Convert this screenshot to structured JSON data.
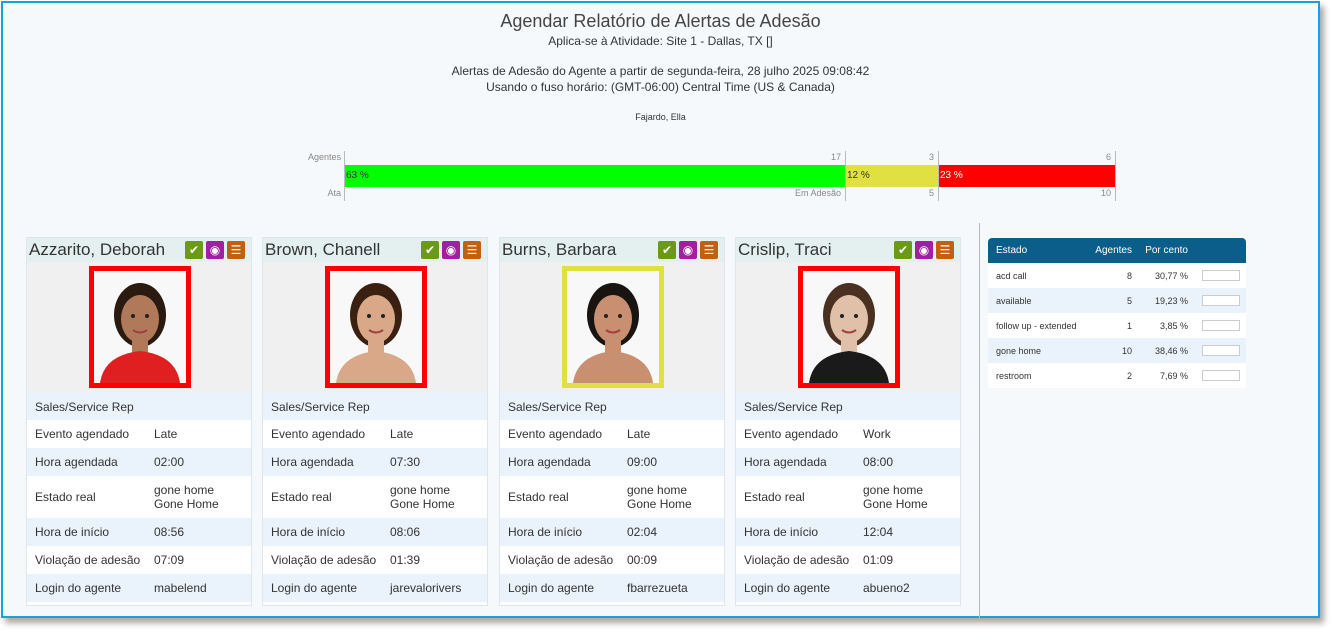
{
  "header": {
    "title": "Agendar Relatório de Alertas de Adesão",
    "subtitle": "Aplica-se à Atividade: Site 1 - Dallas, TX []",
    "alert_line1": "Alertas de Adesão do Agente a partir de segunda-feira, 28 julho 2025 09:08:42",
    "alert_line2": "Usando o fuso horário: (GMT-06:00) Central Time (US & Canada)",
    "agent_name": "Fajardo, Ella"
  },
  "bar": {
    "label_top": "Agentes",
    "label_bottom": "Ata",
    "segments": [
      {
        "label": "63 %",
        "fraction": 0.65,
        "color": "#00ff00",
        "count": "17",
        "bottom": "Em Adesão"
      },
      {
        "label": "12 %",
        "fraction": 0.12,
        "color": "#e0e040",
        "count": "3",
        "bottom": "5"
      },
      {
        "label": "23 %",
        "fraction": 0.23,
        "color": "#ff0000",
        "count": "6",
        "bottom": "10"
      }
    ]
  },
  "cards": [
    {
      "name": "Azzarito, Deborah",
      "border_color": "#ff0000",
      "role": "Sales/Service Rep",
      "rows": [
        {
          "key": "Evento agendado",
          "value": "Late"
        },
        {
          "key": "Hora agendada",
          "value": "02:00"
        },
        {
          "key": "Estado real",
          "value": "gone home",
          "value2": "Gone Home"
        },
        {
          "key": "Hora de início",
          "value": "08:56"
        },
        {
          "key": "Violação de adesão",
          "value": "07:09"
        },
        {
          "key": "Login do agente",
          "value": "mabelend"
        }
      ]
    },
    {
      "name": "Brown, Chanell",
      "border_color": "#ff0000",
      "role": "Sales/Service Rep",
      "rows": [
        {
          "key": "Evento agendado",
          "value": "Late"
        },
        {
          "key": "Hora agendada",
          "value": "07:30"
        },
        {
          "key": "Estado real",
          "value": "gone home",
          "value2": "Gone Home"
        },
        {
          "key": "Hora de início",
          "value": "08:06"
        },
        {
          "key": "Violação de adesão",
          "value": "01:39"
        },
        {
          "key": "Login do agente",
          "value": "jarevalorivers"
        }
      ]
    },
    {
      "name": "Burns, Barbara",
      "border_color": "#e0e040",
      "role": "Sales/Service Rep",
      "rows": [
        {
          "key": "Evento agendado",
          "value": "Late"
        },
        {
          "key": "Hora agendada",
          "value": "09:00"
        },
        {
          "key": "Estado real",
          "value": "gone home",
          "value2": "Gone Home"
        },
        {
          "key": "Hora de início",
          "value": "02:04"
        },
        {
          "key": "Violação de adesão",
          "value": "00:09"
        },
        {
          "key": "Login do agente",
          "value": "fbarrezueta"
        }
      ]
    },
    {
      "name": "Crislip, Traci",
      "border_color": "#ff0000",
      "role": "Sales/Service Rep",
      "rows": [
        {
          "key": "Evento agendado",
          "value": "Work"
        },
        {
          "key": "Hora agendada",
          "value": "08:00"
        },
        {
          "key": "Estado real",
          "value": "gone home",
          "value2": "Gone Home"
        },
        {
          "key": "Hora de início",
          "value": "12:04"
        },
        {
          "key": "Violação de adesão",
          "value": "01:09"
        },
        {
          "key": "Login do agente",
          "value": "abueno2"
        }
      ]
    }
  ],
  "icons": [
    "check-icon",
    "eye-icon",
    "note-icon"
  ],
  "stats": {
    "headers": [
      "Estado",
      "Agentes",
      "Por cento"
    ],
    "rows": [
      {
        "estado": "acd call",
        "agentes": "8",
        "pct": "30,77 %"
      },
      {
        "estado": "available",
        "agentes": "5",
        "pct": "19,23 %"
      },
      {
        "estado": "follow up - extended",
        "agentes": "1",
        "pct": "3,85 %"
      },
      {
        "estado": "gone home",
        "agentes": "10",
        "pct": "38,46 %"
      },
      {
        "estado": "restroom",
        "agentes": "2",
        "pct": "7,69 %"
      }
    ]
  }
}
